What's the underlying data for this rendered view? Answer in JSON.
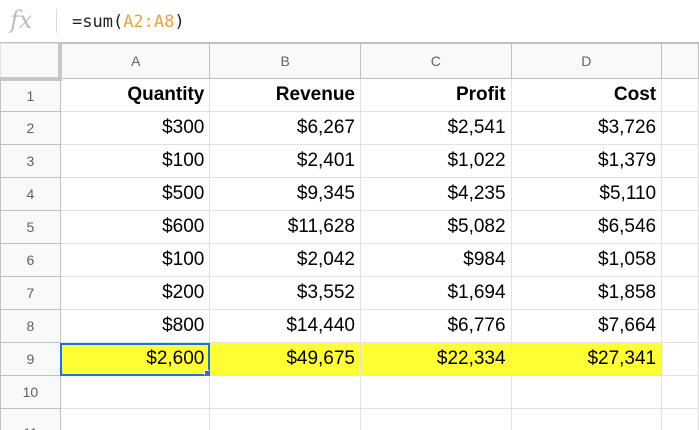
{
  "formula_bar": {
    "fx_label": "fx",
    "formula_prefix": "=sum(",
    "formula_range": "A2:A8",
    "formula_suffix": ")",
    "range_color": "#f2a13a"
  },
  "columns": [
    "A",
    "B",
    "C",
    "D"
  ],
  "rows": [
    {
      "num": "1",
      "cells": [
        "Quantity",
        "Revenue",
        "Profit",
        "Cost"
      ]
    },
    {
      "num": "2",
      "cells": [
        "$300",
        "$6,267",
        "$2,541",
        "$3,726"
      ]
    },
    {
      "num": "3",
      "cells": [
        "$100",
        "$2,401",
        "$1,022",
        "$1,379"
      ]
    },
    {
      "num": "4",
      "cells": [
        "$500",
        "$9,345",
        "$4,235",
        "$5,110"
      ]
    },
    {
      "num": "5",
      "cells": [
        "$600",
        "$11,628",
        "$5,082",
        "$6,546"
      ]
    },
    {
      "num": "6",
      "cells": [
        "$100",
        "$2,042",
        "$984",
        "$1,058"
      ]
    },
    {
      "num": "7",
      "cells": [
        "$200",
        "$3,552",
        "$1,694",
        "$1,858"
      ]
    },
    {
      "num": "8",
      "cells": [
        "$800",
        "$14,440",
        "$6,776",
        "$7,664"
      ]
    },
    {
      "num": "9",
      "cells": [
        "$2,600",
        "$49,675",
        "$22,334",
        "$27,341"
      ]
    },
    {
      "num": "10",
      "cells": [
        "",
        "",
        "",
        ""
      ]
    },
    {
      "num": "11",
      "cells": [
        "",
        "",
        "",
        ""
      ]
    }
  ],
  "selected_cell": "A9",
  "highlight_color": "#ffff33",
  "selection_color": "#1a73e8"
}
